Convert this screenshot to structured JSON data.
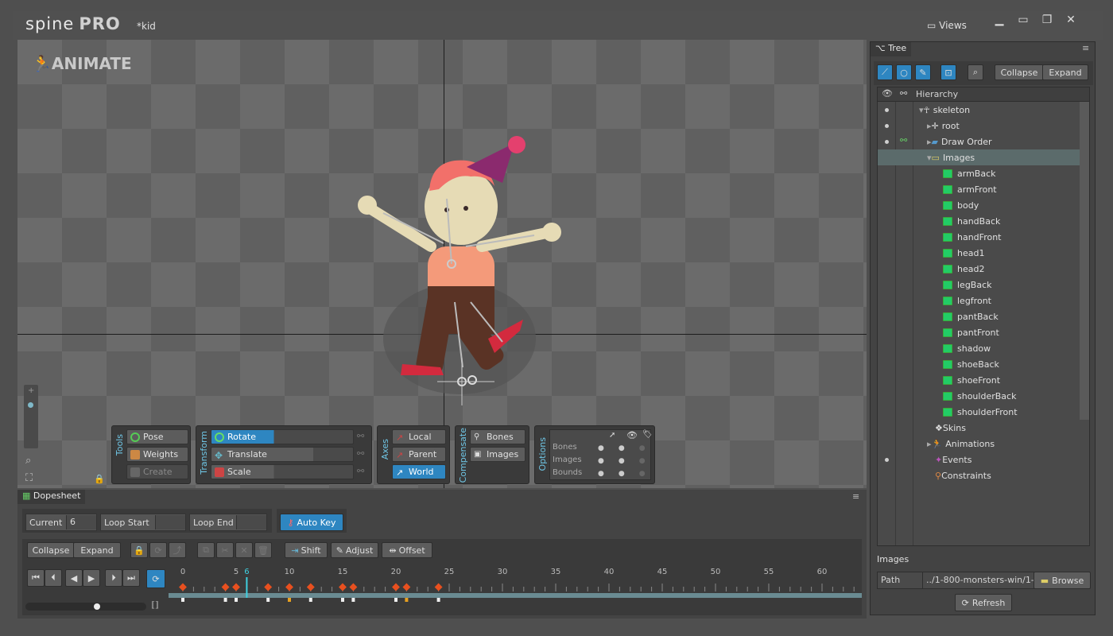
{
  "app": {
    "logo": "spine",
    "edition": "PRO",
    "document": "*kid",
    "views_label": "Views",
    "mode_label": "ANIMATE"
  },
  "window_controls": [
    "minimize",
    "maximize",
    "restore",
    "close"
  ],
  "toolbar": {
    "tools": {
      "group_label": "Tools",
      "pose": "Pose",
      "weights": "Weights",
      "create": "Create"
    },
    "transform": {
      "group_label": "Transform",
      "rotate": "Rotate",
      "translate": "Translate",
      "scale": "Scale"
    },
    "axes": {
      "group_label": "Axes",
      "local": "Local",
      "parent": "Parent",
      "world": "World"
    },
    "compensate": {
      "group_label": "Compensate",
      "bones": "Bones",
      "images": "Images"
    },
    "options": {
      "group_label": "Options",
      "rows": [
        "Bones",
        "Images",
        "Bounds"
      ]
    }
  },
  "tree_panel": {
    "tab": "Tree",
    "collapse": "Collapse",
    "expand": "Expand",
    "header": "Hierarchy",
    "skeleton": "skeleton",
    "root": "root",
    "draw_order": "Draw Order",
    "images": "Images",
    "image_items": [
      "armBack",
      "armFront",
      "body",
      "handBack",
      "handFront",
      "head1",
      "head2",
      "legBack",
      "legfront",
      "pantBack",
      "pantFront",
      "shadow",
      "shoeBack",
      "shoeFront",
      "shoulderBack",
      "shoulderFront"
    ],
    "skins": "Skins",
    "animations": "Animations",
    "events": "Events",
    "constraints": "Constraints"
  },
  "images_panel": {
    "title": "Images",
    "path_label": "Path",
    "path_value": "../1-800-monsters-win/1-",
    "browse": "Browse",
    "refresh": "Refresh"
  },
  "dopesheet": {
    "tab": "Dopesheet",
    "current_label": "Current",
    "current_value": "6",
    "loop_start": "Loop Start",
    "loop_end": "Loop End",
    "auto_key": "Auto Key",
    "collapse": "Collapse",
    "expand": "Expand",
    "shift": "Shift",
    "adjust": "Adjust",
    "offset": "Offset",
    "ruler": [
      "0",
      "5",
      "10",
      "15",
      "20",
      "25",
      "30",
      "35",
      "40",
      "45",
      "50",
      "55",
      "60"
    ],
    "current_frame": 6,
    "keyframes": [
      0,
      4,
      5,
      8,
      10,
      12,
      15,
      16,
      20,
      21,
      24
    ]
  },
  "colors": {
    "accent": "#2e86c1",
    "label_cyan": "#6fc6e6",
    "key": "#e8501f"
  }
}
